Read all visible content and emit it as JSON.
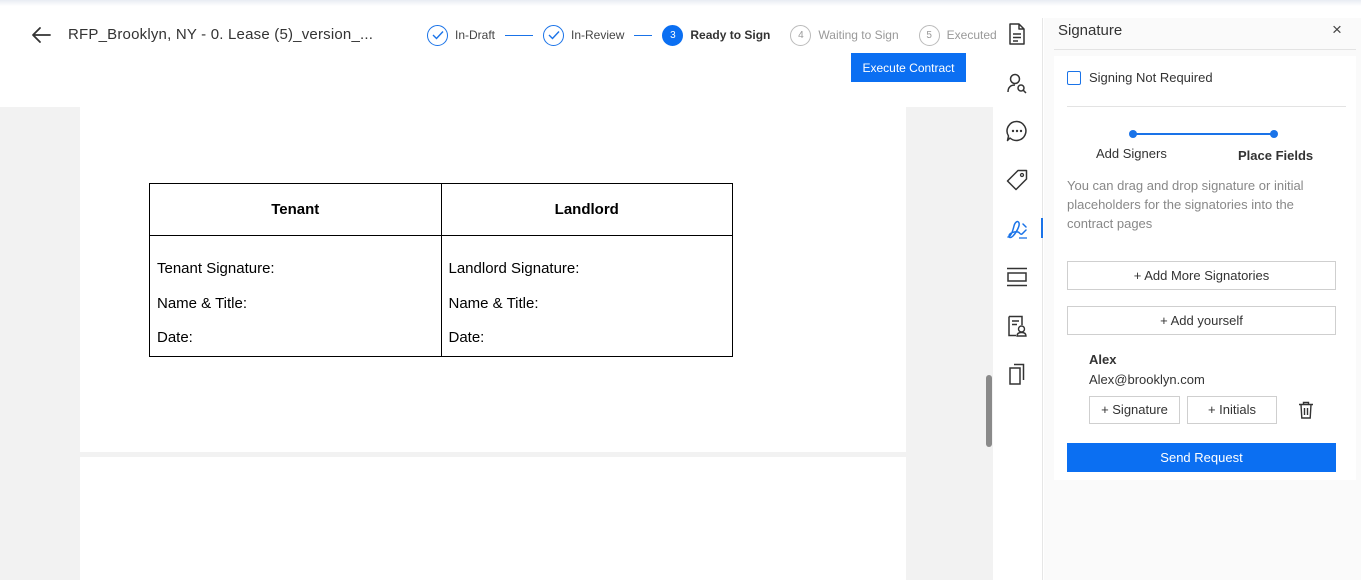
{
  "header": {
    "document_title": "RFP_Brooklyn, NY - 0. Lease (5)_version_...",
    "execute_button": "Execute Contract"
  },
  "stepper": [
    {
      "label": "In-Draft",
      "state": "done",
      "marker": ""
    },
    {
      "label": "In-Review",
      "state": "done",
      "marker": ""
    },
    {
      "label": "Ready to Sign",
      "state": "active",
      "marker": "3"
    },
    {
      "label": "Waiting to Sign",
      "state": "todo",
      "marker": "4"
    },
    {
      "label": "Executed",
      "state": "todo",
      "marker": "5"
    }
  ],
  "document": {
    "table": {
      "headers": [
        "Tenant",
        "Landlord"
      ],
      "rows": [
        [
          "Tenant Signature:",
          "Landlord Signature:"
        ],
        [
          "Name & Title:",
          "Name & Title:"
        ],
        [
          "Date:",
          "Date:"
        ]
      ]
    }
  },
  "rail": {
    "icons": [
      "document-icon",
      "user-search-icon",
      "comment-icon",
      "tag-icon",
      "signature-icon",
      "layout-icon",
      "certificate-icon",
      "copy-icon"
    ],
    "active": "signature-icon"
  },
  "panel": {
    "title": "Signature",
    "close": "×",
    "signing_not_required": "Signing Not Required",
    "progress": [
      "Add Signers",
      "Place Fields"
    ],
    "help_text": "You can drag and drop signature or initial placeholders for the signatories into the contract pages",
    "add_more_signatories": "+ Add More Signatories",
    "add_yourself": "+ Add yourself",
    "signer": {
      "name": "Alex",
      "email": "Alex@brooklyn.com",
      "signature_button": "+ Signature",
      "initials_button": "+ Initials"
    },
    "send_request": "Send Request"
  },
  "colors": {
    "accent": "#0b6ff2",
    "canvas": "#f2f2f2"
  }
}
